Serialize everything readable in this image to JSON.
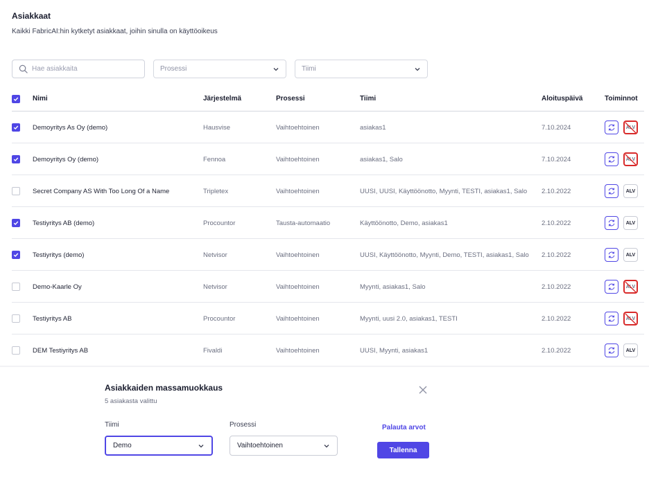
{
  "page": {
    "title": "Asiakkaat",
    "subtitle": "Kaikki FabricAI:hin kytketyt asiakkaat, joihin sinulla on käyttöoikeus"
  },
  "filters": {
    "search_placeholder": "Hae asiakkaita",
    "process_placeholder": "Prosessi",
    "team_placeholder": "Tiimi"
  },
  "table": {
    "header_checked": true,
    "columns": {
      "name": "Nimi",
      "system": "Järjestelmä",
      "process": "Prosessi",
      "team": "Tiimi",
      "start_date": "Aloituspäivä",
      "actions": "Toiminnot"
    },
    "alv_label": "ALV",
    "rows": [
      {
        "checked": true,
        "name": "Demoyritys As Oy (demo)",
        "system": "Hausvise",
        "process": "Vaihtoehtoinen",
        "team": "asiakas1",
        "start_date": "7.10.2024",
        "alv_enabled": false
      },
      {
        "checked": true,
        "name": "Demoyritys Oy (demo)",
        "system": "Fennoa",
        "process": "Vaihtoehtoinen",
        "team": "asiakas1, Salo",
        "start_date": "7.10.2024",
        "alv_enabled": false
      },
      {
        "checked": false,
        "name": "Secret Company AS With Too Long Of a Name",
        "system": "Tripletex",
        "process": "Vaihtoehtoinen",
        "team": "UUSI, UUSI, Käyttöönotto, Myynti, TESTI, asiakas1, Salo",
        "start_date": "2.10.2022",
        "alv_enabled": true
      },
      {
        "checked": true,
        "name": "Testiyritys AB (demo)",
        "system": "Procountor",
        "process": "Tausta-automaatio",
        "team": "Käyttöönotto, Demo, asiakas1",
        "start_date": "2.10.2022",
        "alv_enabled": true
      },
      {
        "checked": true,
        "name": "Testiyritys (demo)",
        "system": "Netvisor",
        "process": "Vaihtoehtoinen",
        "team": "UUSI, Käyttöönotto, Myynti, Demo, TESTI, asiakas1, Salo",
        "start_date": "2.10.2022",
        "alv_enabled": true
      },
      {
        "checked": false,
        "name": "Demo-Kaarle Oy",
        "system": "Netvisor",
        "process": "Vaihtoehtoinen",
        "team": "Myynti, asiakas1, Salo",
        "start_date": "2.10.2022",
        "alv_enabled": false
      },
      {
        "checked": false,
        "name": "Testiyritys AB",
        "system": "Procountor",
        "process": "Vaihtoehtoinen",
        "team": "Myynti, uusi 2.0, asiakas1, TESTI",
        "start_date": "2.10.2022",
        "alv_enabled": false
      },
      {
        "checked": false,
        "name": "DEM Testiyritys AB",
        "system": "Fivaldi",
        "process": "Vaihtoehtoinen",
        "team": "UUSI, Myynti, asiakas1",
        "start_date": "2.10.2022",
        "alv_enabled": true
      }
    ]
  },
  "bulk_edit": {
    "title": "Asiakkaiden massamuokkaus",
    "selected_count": "5 asiakasta valittu",
    "team_label": "Tiimi",
    "team_value": "Demo",
    "process_label": "Prosessi",
    "process_value": "Vaihtoehtoinen",
    "reset_label": "Palauta arvot",
    "save_label": "Tallenna"
  },
  "colors": {
    "accent": "#4f46e5",
    "alv_disabled": "#d82a2a"
  }
}
